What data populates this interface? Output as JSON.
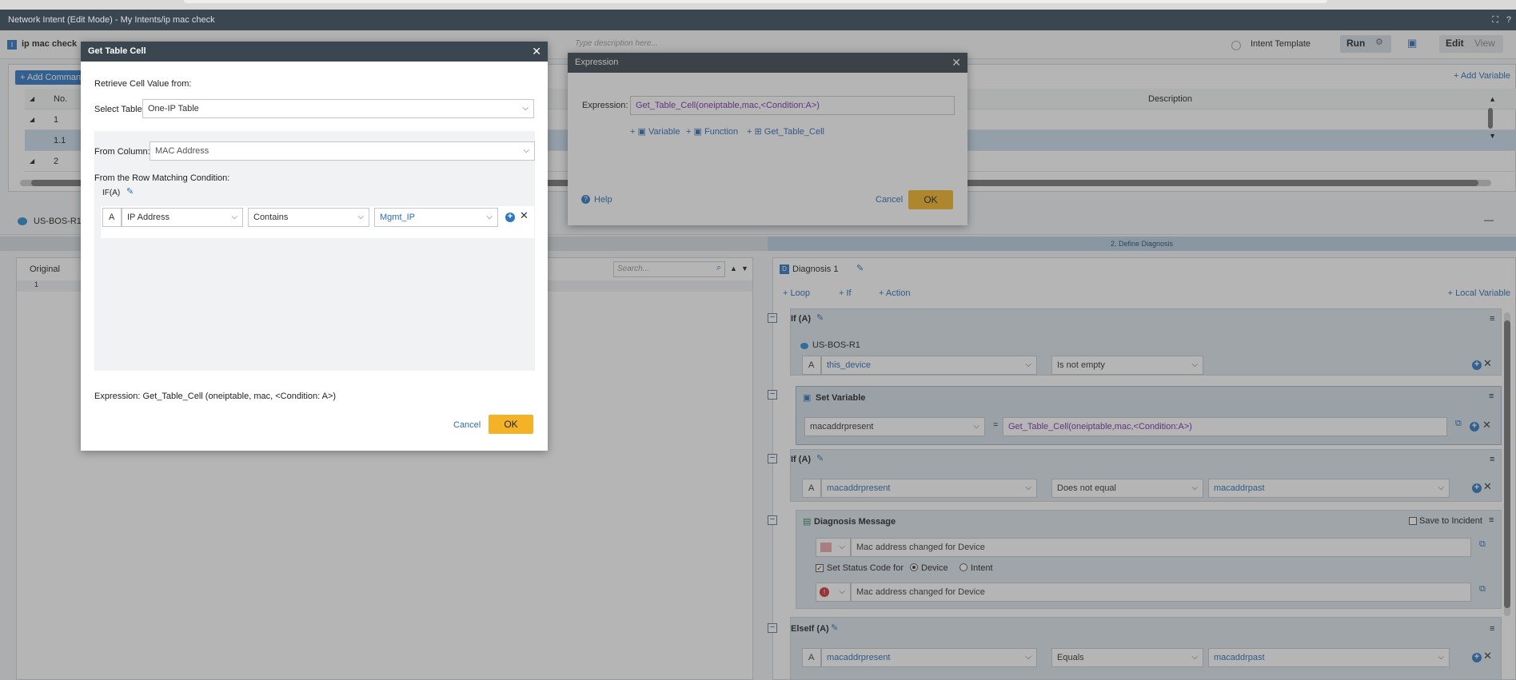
{
  "window": {
    "title": "Network Intent (Edit Mode) - My Intents/ip mac check",
    "fullscreen_icon": "expand-icon",
    "help_icon": "question-icon"
  },
  "toolbar": {
    "intent_name": "ip mac check",
    "description_placeholder": "Type description here...",
    "intent_template_label": "Intent Template",
    "run_label": "Run",
    "edit_label": "Edit",
    "view_label": "View"
  },
  "grid": {
    "add_command_label": "+ Add Command",
    "add_variable_label": "+ Add Variable",
    "col_no": "No.",
    "col_description": "Description",
    "rows": [
      {
        "no": "1"
      },
      {
        "no": "1.1"
      },
      {
        "no": "2"
      }
    ]
  },
  "device_panel": {
    "device_name": "US-BOS-R1",
    "original_tab": "Original",
    "search_placeholder": "Search...",
    "line_no": "1"
  },
  "diagnosis": {
    "step_header": "2. Define Diagnosis",
    "selector_label": "Diagnosis 1",
    "loop_label": "+ Loop",
    "if_label": "+ If",
    "action_label": "+ Action",
    "local_var_label": "+ Local Variable",
    "if_a": {
      "title": "If (A)",
      "device": "US-BOS-R1",
      "letter": "A",
      "var": "this_device",
      "op": "Is not empty"
    },
    "set_var": {
      "title": "Set Variable",
      "var": "macaddrpresent",
      "eq": "=",
      "expr": "Get_Table_Cell(oneiptable,mac,<Condition:A>)"
    },
    "if_a2": {
      "title": "If (A)",
      "letter": "A",
      "var": "macaddrpresent",
      "op": "Does not equal",
      "value": "macaddrpast"
    },
    "message": {
      "title": "Diagnosis Message",
      "save_incident": "Save to Incident",
      "text1": "Mac address changed for Device",
      "set_status": "Set Status Code for",
      "opt_device": "Device",
      "opt_intent": "Intent",
      "text2": "Mac address changed for Device"
    },
    "elseif": {
      "title": "ElseIf (A)",
      "letter": "A",
      "var": "macaddrpresent",
      "op": "Equals",
      "value": "macaddrpast"
    }
  },
  "get_table_cell": {
    "title": "Get Table Cell",
    "retrieve_label": "Retrieve Cell Value from:",
    "select_table_label": "Select Table:",
    "select_table_value": "One-IP Table",
    "from_column_label": "From Column:",
    "from_column_value": "MAC Address",
    "row_matching_label": "From the Row Matching Condition:",
    "if_label": "IF(A)",
    "cond_letter": "A",
    "cond_column": "IP Address",
    "cond_op": "Contains",
    "cond_value": "Mgmt_IP",
    "expression": "Expression: Get_Table_Cell (oneiptable, mac, <Condition: A>)",
    "cancel": "Cancel",
    "ok": "OK"
  },
  "expression_dialog": {
    "title": "Expression",
    "label": "Expression:",
    "value": "Get_Table_Cell(oneiptable,mac,<Condition:A>)",
    "add_variable": "Variable",
    "add_function": "Function",
    "add_get_table_cell": "Get_Table_Cell",
    "help": "Help",
    "cancel": "Cancel",
    "ok": "OK"
  },
  "colors": {
    "accent": "#f4b326",
    "titlebar": "#3b4750",
    "link": "#2c6db5",
    "expr": "#7a2fa8"
  }
}
